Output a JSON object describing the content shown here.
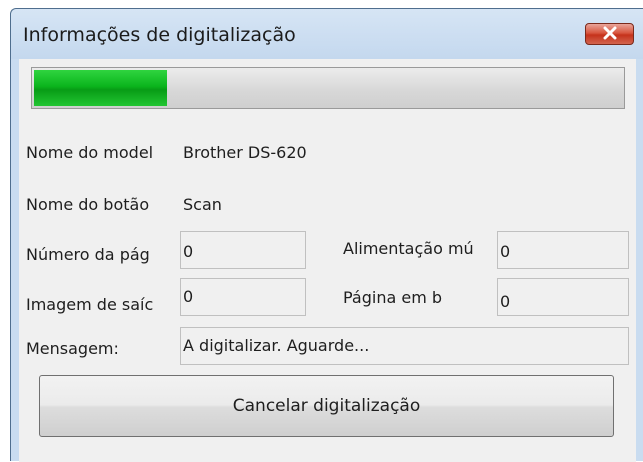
{
  "window": {
    "title": "Informações de digitalização",
    "close_icon": "close-icon",
    "close_color": "#c5321b"
  },
  "progress": {
    "fraction": 0.225,
    "color": "#0bb51d"
  },
  "fields": {
    "model_label": "Nome do model",
    "model_value": "Brother DS-620",
    "button_label": "Nome do botão",
    "button_value": "Scan",
    "page_num_label": "Número da pág",
    "page_num_value": "0",
    "multifeed_label": "Alimentação mú",
    "multifeed_value": "0",
    "output_image_label": "Imagem de saíc",
    "output_image_value": "0",
    "blank_page_label": "Página em b",
    "blank_page_value": "0",
    "message_label": "Mensagem:",
    "message_value": "A digitalizar. Aguarde..."
  },
  "buttons": {
    "cancel_label": "Cancelar digitalização"
  }
}
